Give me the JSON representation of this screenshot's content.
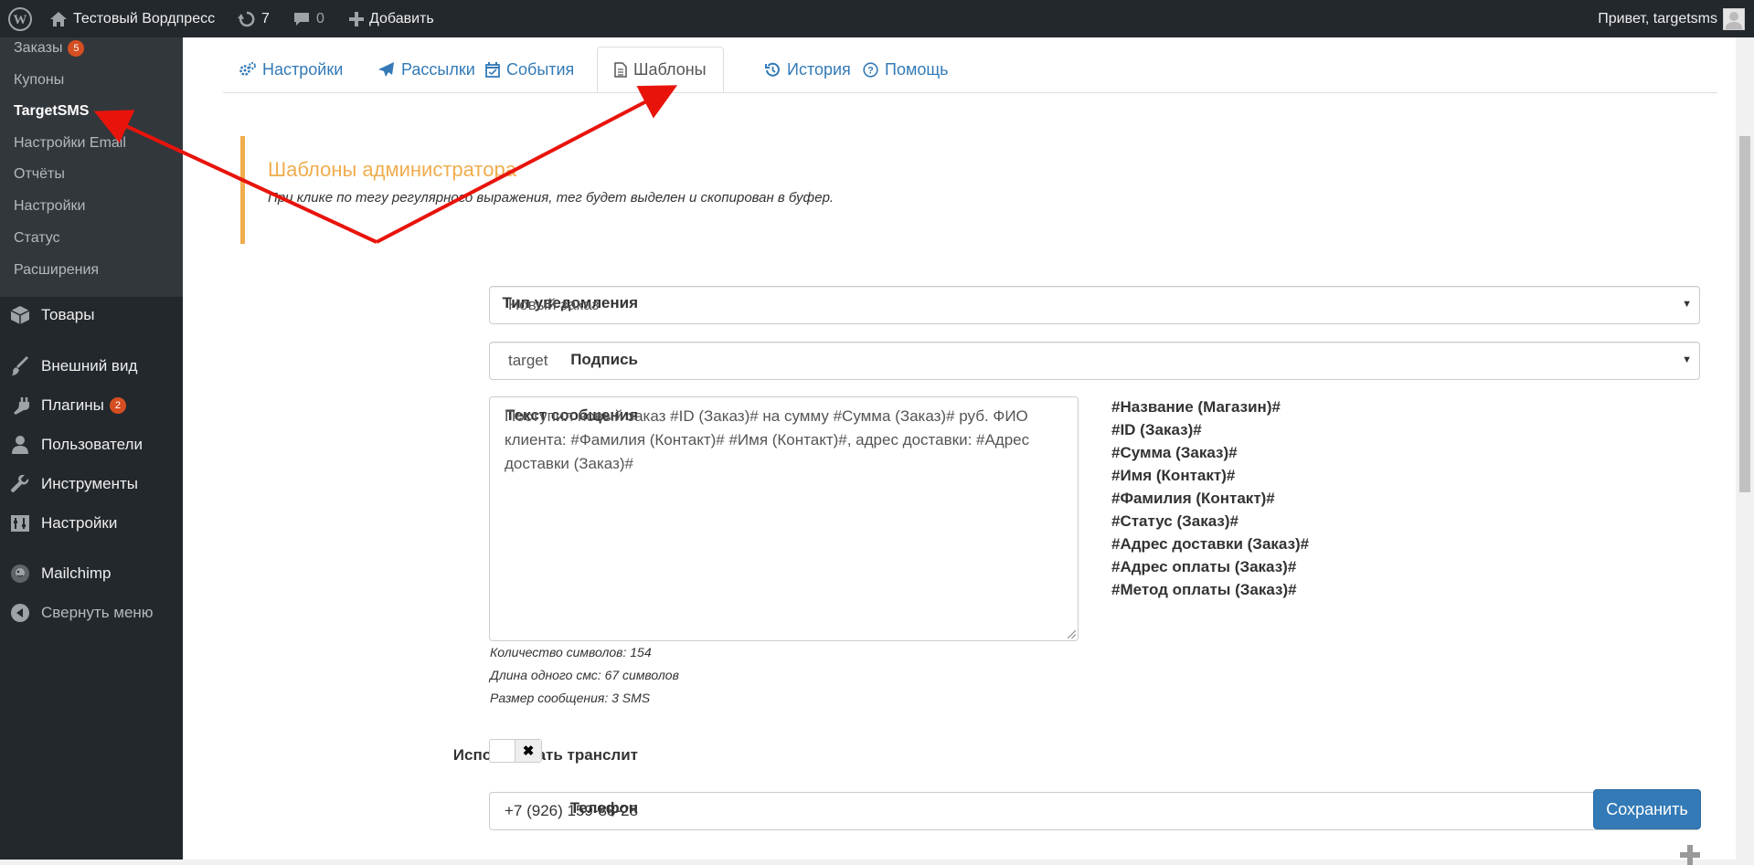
{
  "adminbar": {
    "site_title": "Тестовый Вордпресс",
    "updates_count": "7",
    "comments_count": "0",
    "add_new_label": "Добавить",
    "greeting": "Привет, targetsms"
  },
  "sidebar": {
    "submenu": [
      {
        "label": "Заказы",
        "badge": "5"
      },
      {
        "label": "Купоны"
      },
      {
        "label": "TargetSMS"
      },
      {
        "label": "Настройки Email"
      },
      {
        "label": "Отчёты"
      },
      {
        "label": "Настройки"
      },
      {
        "label": "Статус"
      },
      {
        "label": "Расширения"
      }
    ],
    "menu": [
      {
        "label": "Товары",
        "icon": "box-icon"
      },
      {
        "label": "Внешний вид",
        "icon": "brush-icon"
      },
      {
        "label": "Плагины",
        "icon": "plug-icon",
        "badge": "2"
      },
      {
        "label": "Пользователи",
        "icon": "user-icon"
      },
      {
        "label": "Инструменты",
        "icon": "wrench-icon"
      },
      {
        "label": "Настройки",
        "icon": "settings-icon"
      },
      {
        "label": "Mailchimp",
        "icon": "mailchimp-icon"
      },
      {
        "label": "Свернуть меню",
        "icon": "collapse-icon"
      }
    ]
  },
  "tabs": [
    {
      "label": "Настройки",
      "icon": "gears-icon"
    },
    {
      "label": "Рассылки",
      "icon": "paper-plane-icon"
    },
    {
      "label": "События",
      "icon": "calendar-icon"
    },
    {
      "label": "Шаблоны",
      "icon": "file-icon",
      "active": true
    },
    {
      "label": "История",
      "icon": "history-icon"
    },
    {
      "label": "Помощь",
      "icon": "question-icon"
    }
  ],
  "callout": {
    "title": "Шаблоны администратора",
    "text": "При клике по тегу регулярного выражения, тег будет выделен и скопирован в буфер."
  },
  "form": {
    "notification_type": {
      "label": "Тип уведомления",
      "value": "Новый заказ"
    },
    "signature": {
      "label": "Подпись",
      "value": "target"
    },
    "message": {
      "label": "Текст сообщения",
      "value": "Поступил новый заказ #ID (Заказ)# на сумму #Сумма (Заказ)# руб. ФИО клиента: #Фамилия (Контакт)# #Имя (Контакт)#, адрес доставки: #Адрес доставки (Заказ)#",
      "char_count": "Количество символов: 154",
      "sms_length": "Длина одного смс: 67 символов",
      "message_size": "Размер сообщения: 3 SMS"
    },
    "tags": [
      "#Название (Магазин)#",
      "#ID (Заказ)#",
      "#Сумма (Заказ)#",
      "#Имя (Контакт)#",
      "#Фамилия (Контакт)#",
      "#Статус (Заказ)#",
      "#Адрес доставки (Заказ)#",
      "#Адрес оплаты (Заказ)#",
      "#Метод оплаты (Заказ)#"
    ],
    "translit": {
      "label": "Использовать транслит",
      "toggle_symbol": "✖"
    },
    "phone": {
      "label": "Телефон",
      "value": "+7 (926) 159-88-28"
    },
    "save_label": "Сохранить"
  },
  "colors": {
    "link": "#337ab7",
    "warning": "#f0ad4e",
    "annotation_arrow": "#e8140c",
    "adminbar": "#23282d"
  }
}
